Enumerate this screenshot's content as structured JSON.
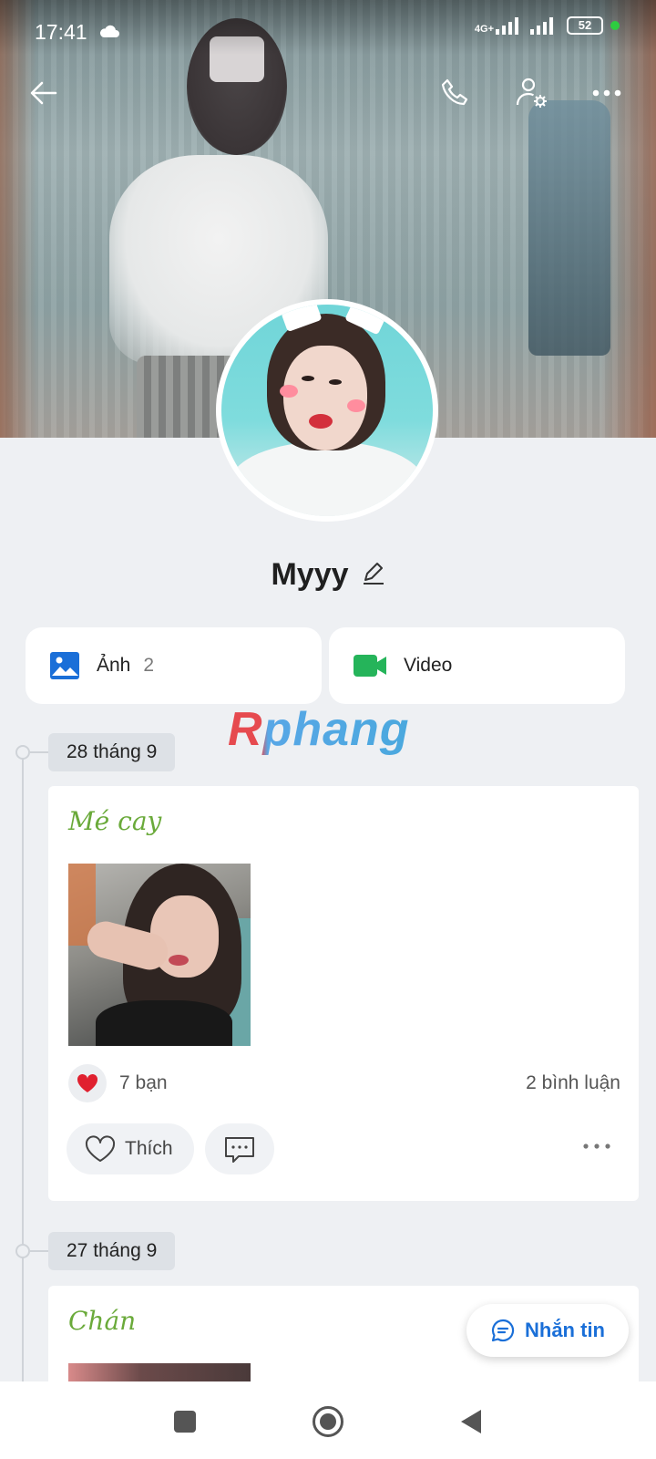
{
  "status_bar": {
    "time": "17:41",
    "network_label": "4G+",
    "battery": "52",
    "icons": [
      "cloud-icon",
      "signal-icon",
      "signal-icon",
      "battery-icon",
      "charging-dot-icon"
    ]
  },
  "toolbar": {
    "back_icon": "arrow-left-icon",
    "call_icon": "phone-icon",
    "settings_icon": "user-settings-icon",
    "more_icon": "more-horizontal-icon"
  },
  "profile": {
    "name": "Myyy",
    "edit_icon": "pencil-icon"
  },
  "media": {
    "photos_label": "Ảnh",
    "photos_count": "2",
    "video_label": "Video",
    "photo_accent": "#1a6fd8",
    "video_accent": "#25b45a"
  },
  "watermark": "Rphang",
  "posts": [
    {
      "date": "28 tháng 9",
      "text": "Mé cay",
      "reactions": "7 bạn",
      "comments": "2 bình luận",
      "like_label": "Thích"
    },
    {
      "date": "27 tháng 9",
      "text": "Chán"
    }
  ],
  "fab": {
    "label": "Nhắn tin",
    "color": "#1a6fd8"
  },
  "nav": {
    "recent_icon": "square-icon",
    "home_icon": "circle-icon",
    "back_icon": "triangle-back-icon"
  }
}
